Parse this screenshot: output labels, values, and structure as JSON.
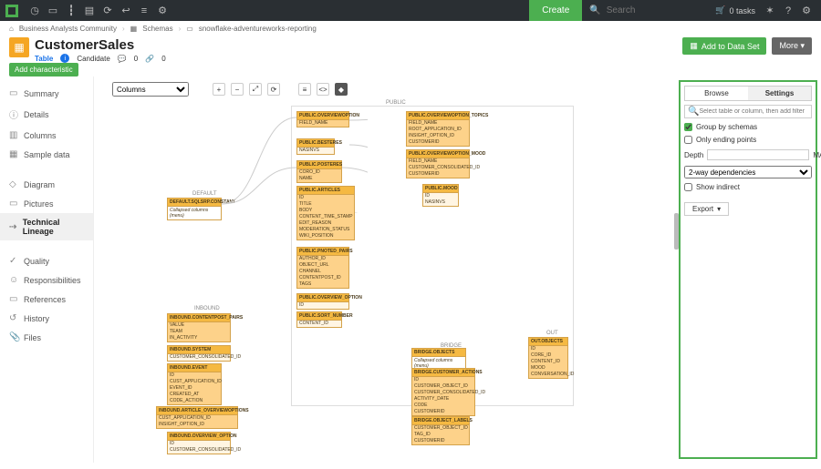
{
  "topbar": {
    "create": "Create",
    "search_placeholder": "Search",
    "tasks": "0 tasks"
  },
  "breadcrumb": {
    "a": "Business Analysts Community",
    "b": "Schemas",
    "c": "snowflake-adventureworks-reporting"
  },
  "header": {
    "title": "CustomerSales",
    "type": "Table",
    "status": "Candidate",
    "count1": "0",
    "count2": "0",
    "add_to_dataset": "Add to Data Set",
    "more": "More"
  },
  "add_char": "Add characteristic",
  "sidebar": {
    "summary": "Summary",
    "details": "Details",
    "columns": "Columns",
    "sample": "Sample data",
    "diagram": "Diagram",
    "pictures": "Pictures",
    "lineage": "Technical Lineage",
    "quality": "Quality",
    "resp": "Responsibilities",
    "refs": "References",
    "history": "History",
    "files": "Files"
  },
  "canvas": {
    "dropdown": "Columns",
    "group_public": "PUBLIC",
    "group_default": "DEFAULT",
    "group_inbound": "INBOUND",
    "group_bridge": "BRIDGE",
    "group_out": "OUT",
    "collapsed": "Collapsed columns (menu)",
    "nodes": {
      "default_const": "DEFAULT.SQLSRP.CONSTANT",
      "overviewoption": "PUBLIC.OVERVIEWOPTION",
      "overviewoption_c1": "FIELD_NAME",
      "besteres": "PUBLIC.BESTERES",
      "besteres_c1": "NASINVS",
      "posteres": "PUBLIC.POSTERES",
      "posteres_c1": "CORO_ID",
      "posteres_c2": "NAME",
      "articles": "PUBLIC.ARTICLES",
      "articles_c": [
        "ID",
        "TITLE",
        "BODY",
        "CONTENT_TIME_STAMP",
        "EDIT_REASON",
        "MODERATION_STATUS",
        "WIKI_POSITION"
      ],
      "pnotedpairs": "PUBLIC.PNOTED_PAIRS",
      "pnotedpairs_c": [
        "AUTHOR_ID",
        "OBJECT_URL",
        "CHANNEL",
        "CONTENTPOST_ID",
        "TAGS"
      ],
      "overview_option2": "PUBLIC.OVERVIEW_OPTION",
      "overview_option2_c1": "ID",
      "sort_number": "PUBLIC.SORT_NUMBER",
      "sort_number_c1": "CONTENT_ID",
      "topics": "PUBLIC.OVERVIEWOPTION_TOPICS",
      "topics_c": [
        "FIELD_NAME",
        "ROOT_APPLICATION_ID",
        "INSIGHT_OPTION_ID",
        "CUSTOMERID"
      ],
      "mood": "PUBLIC.OVERVIEWOPTION_MOOD",
      "mood_c": [
        "FIELD_NAME",
        "CUSTOMER_CONSOLIDATED_ID",
        "CUSTOMERID"
      ],
      "pmood": "PUBLIC.MOOD",
      "pmood_c": [
        "ID",
        "NASINVS"
      ],
      "in_contentpost": "INBOUND.CONTENTPOST_PAIRS",
      "in_contentpost_c": [
        "VALUE",
        "TEAM",
        "IN_ACTIVITY"
      ],
      "in_system": "INBOUND.SYSTEM",
      "in_system_c1": "CUSTOMER_CONSOLIDATED_ID",
      "in_event": "INBOUND.EVENT",
      "in_event_c": [
        "ID",
        "CUST_APPLICATION_ID",
        "EVENT_ID",
        "CREATED_AT",
        "CODE_ACTION"
      ],
      "in_article_ov": "INBOUND.ARTICLE_OVERVIEWOPTIONS",
      "in_article_ov_c": [
        "CUST_APPLICATION_ID",
        "INSIGHT_OPTION_ID"
      ],
      "in_ov_option": "INBOUND.OVERVIEW_OPTION",
      "in_ov_option_c": [
        "ID",
        "CUSTOMER_CONSOLIDATED_ID"
      ],
      "bridge_objects": "BRIDGE.OBJECTS",
      "bridge_cust_actions": "BRIDGE.CUSTOMER_ACTIONS",
      "bridge_cust_actions_c": [
        "ID",
        "CUSTOMER_OBJECT_ID",
        "CUSTOMER_CONSOLIDATED_ID",
        "ACTIVITY_DATE",
        "CODE",
        "CUSTOMERID"
      ],
      "bridge_obj_labels": "BRIDGE.OBJECT_LABELS",
      "bridge_obj_labels_c": [
        "CUSTOMER_OBJECT_ID",
        "TAG_ID",
        "CUSTOMERID"
      ],
      "out_objects": "OUT.OBJECTS",
      "out_objects_c": [
        "ID",
        "CORE_ID",
        "CONTENT_ID",
        "MOOD",
        "CONVERSATION_ID"
      ]
    }
  },
  "settings": {
    "tab_browse": "Browse",
    "tab_settings": "Settings",
    "filter_placeholder": "Select table or column, then add filter",
    "group_by_schemas": "Group by schemas",
    "only_ending": "Only ending points",
    "depth_label": "Depth",
    "depth_max": "MAX",
    "dep_select": "2-way dependencies",
    "show_indirect": "Show indirect",
    "export": "Export"
  }
}
